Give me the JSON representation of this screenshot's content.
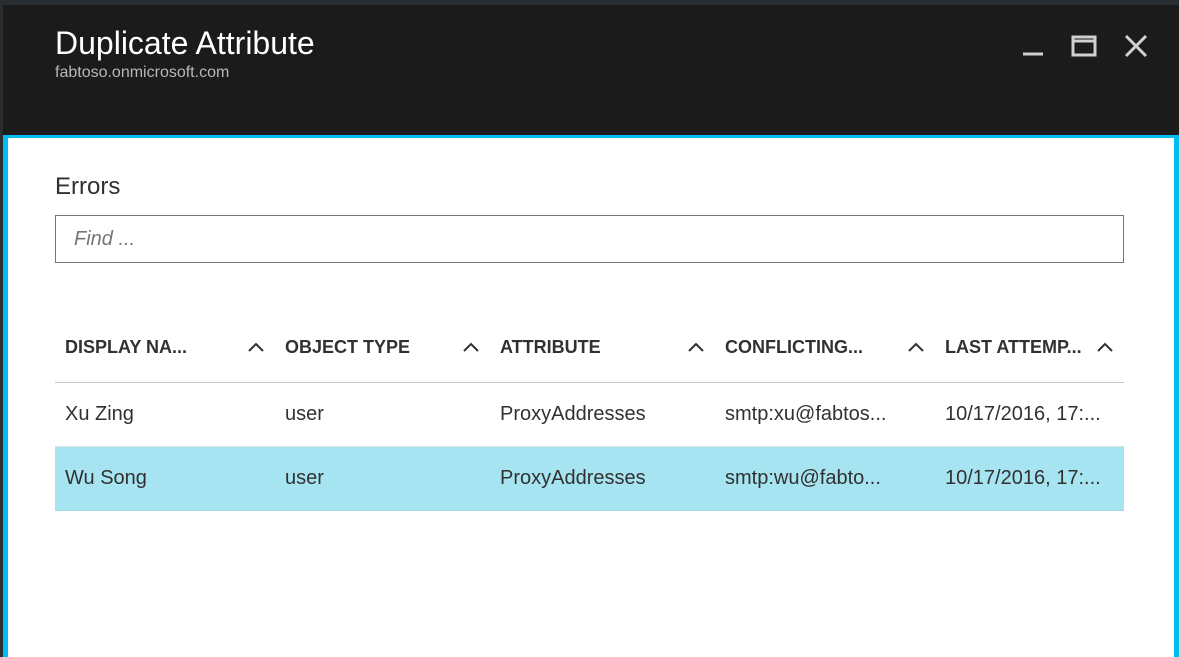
{
  "header": {
    "title": "Duplicate Attribute",
    "subtitle": "fabtoso.onmicrosoft.com"
  },
  "section": {
    "heading": "Errors",
    "search_placeholder": "Find ..."
  },
  "table": {
    "columns": [
      {
        "label": "DISPLAY NA..."
      },
      {
        "label": "OBJECT TYPE"
      },
      {
        "label": "ATTRIBUTE"
      },
      {
        "label": "CONFLICTING..."
      },
      {
        "label": "LAST ATTEMP..."
      }
    ],
    "rows": [
      {
        "display_name": "Xu Zing",
        "object_type": "user",
        "attribute": "ProxyAddresses",
        "conflicting": "smtp:xu@fabtos...",
        "last_attempt": "10/17/2016, 17:..."
      },
      {
        "display_name": "Wu Song",
        "object_type": "user",
        "attribute": "ProxyAddresses",
        "conflicting": "smtp:wu@fabto...",
        "last_attempt": "10/17/2016, 17:..."
      }
    ]
  }
}
